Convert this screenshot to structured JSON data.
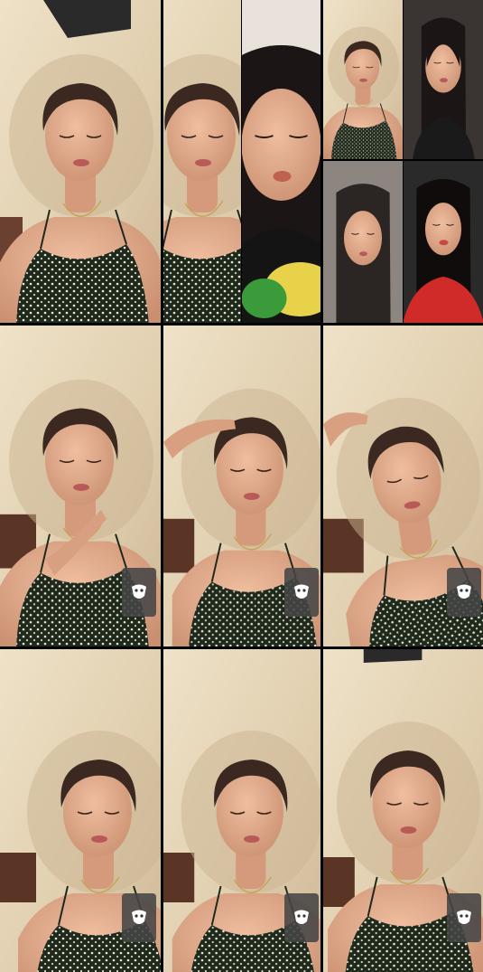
{
  "screen": {
    "title": ""
  },
  "grid": {
    "rows": 3,
    "cols": 3,
    "tiles": [
      {
        "row": 1,
        "col": 1,
        "layout": "single",
        "subject": "short-hair-woman",
        "pose": "eyes-closed"
      },
      {
        "row": 1,
        "col": 2,
        "layout": "split-2",
        "subjects": [
          "short-hair-woman",
          "long-dark-hair-woman"
        ]
      },
      {
        "row": 1,
        "col": 3,
        "layout": "split-4",
        "subjects": [
          "short-hair-woman",
          "long-dark-hair-woman",
          "long-dark-hair-woman",
          "long-dark-hair-woman-red-top"
        ]
      },
      {
        "row": 2,
        "col": 1,
        "layout": "single",
        "subject": "short-hair-woman",
        "pose": "hand-on-neck",
        "has_filter_button": true
      },
      {
        "row": 2,
        "col": 2,
        "layout": "single",
        "subject": "short-hair-woman",
        "pose": "hand-on-head",
        "has_filter_button": true
      },
      {
        "row": 2,
        "col": 3,
        "layout": "single",
        "subject": "short-hair-woman",
        "pose": "hand-on-head-tilt",
        "has_filter_button": true
      },
      {
        "row": 3,
        "col": 1,
        "layout": "single",
        "subject": "short-hair-woman",
        "pose": "eyes-closed-talking",
        "has_filter_button": true
      },
      {
        "row": 3,
        "col": 2,
        "layout": "single",
        "subject": "short-hair-woman",
        "pose": "smiling",
        "has_filter_button": true
      },
      {
        "row": 3,
        "col": 3,
        "layout": "single",
        "subject": "short-hair-woman",
        "pose": "neutral",
        "has_filter_button": true
      }
    ]
  },
  "icons": {
    "filter": "effects-mask-icon"
  },
  "colors": {
    "background": "#000000",
    "wall": "#e3d2b4",
    "skin": "#d9a082",
    "hair": "#3b2820",
    "dress": "#1e2a1c",
    "red_top": "#d02b28"
  }
}
